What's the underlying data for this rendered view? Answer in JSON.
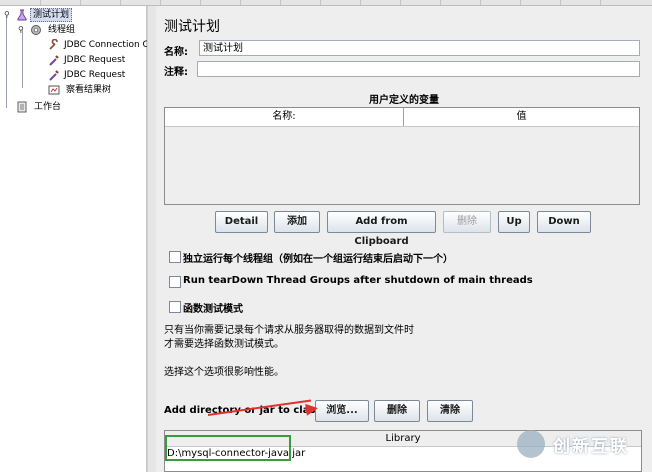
{
  "tree": {
    "items": [
      {
        "label": "测试计划",
        "icon": "test-plan-flask-icon"
      },
      {
        "label": "线程组",
        "icon": "thread-group-icon"
      },
      {
        "label": "JDBC Connection Co",
        "icon": "wrench-icon"
      },
      {
        "label": "JDBC Request",
        "icon": "pipette-icon"
      },
      {
        "label": "JDBC Request",
        "icon": "pipette-icon"
      },
      {
        "label": "察看结果树",
        "icon": "results-tree-icon"
      },
      {
        "label": "工作台",
        "icon": "workbench-icon"
      }
    ]
  },
  "panel": {
    "title": "测试计划",
    "name_label": "名称:",
    "name_value": "测试计划",
    "comment_label": "注释:",
    "comment_value": ""
  },
  "variables": {
    "title": "用户定义的变量",
    "col_name": "名称:",
    "col_value": "值"
  },
  "buttons": {
    "detail": "Detail",
    "add": "添加",
    "add_clipboard": "Add from Clipboard",
    "delete": "删除",
    "up": "Up",
    "down": "Down"
  },
  "options": {
    "independent": "独立运行每个线程组（例如在一个组运行结束后启动下一个）",
    "teardown": "Run tearDown Thread Groups after shutdown of main threads",
    "functional": "函数测试模式"
  },
  "notes": {
    "line1": "只有当你需要记录每个请求从服务器取得的数据到文件时",
    "line2": "才需要选择函数测试模式。",
    "line3": "选择这个选项很影响性能。"
  },
  "classpath": {
    "label": "Add directory or jar to classpath",
    "browse": "浏览...",
    "delete": "删除",
    "clear": "清除",
    "col_library": "Library",
    "entry": "D:\\mysql-connector-java.jar"
  },
  "watermark": {
    "text": "创新互联"
  },
  "colors": {
    "highlight_box": "#3c9a3c",
    "arrow": "#e2322d"
  }
}
